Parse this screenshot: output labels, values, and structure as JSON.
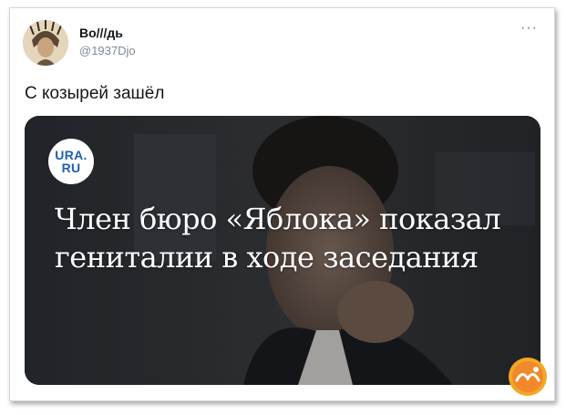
{
  "tweet": {
    "author_name": "Bo///дь",
    "author_handle": "@1937Djo",
    "more_label": "···",
    "text": "С козырей зашёл"
  },
  "card": {
    "logo_line1": "URA.",
    "logo_line2": "RU",
    "headline": "Член бюро «Яблока» показал гениталии в ходе заседания"
  },
  "icons": {
    "avatar": "avatar-icon",
    "more": "more-icon",
    "watermark": "watermark-logo-icon"
  },
  "colors": {
    "logo_blue": "#1e5fb3",
    "watermark_orange": "#f5a623"
  }
}
